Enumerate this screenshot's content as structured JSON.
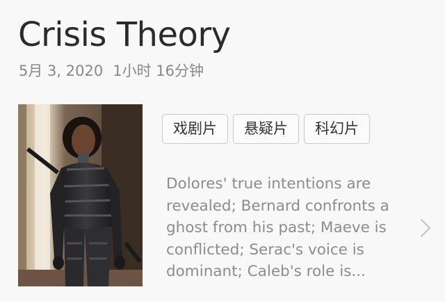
{
  "episode": {
    "title": "Crisis Theory",
    "date": "5月 3, 2020",
    "duration": "1小时 16分钟"
  },
  "genres": [
    "戏剧片",
    "悬疑片",
    "科幻片"
  ],
  "synopsis_lines": [
    "Dolores' true intentions are",
    "revealed; Bernard confronts a",
    "ghost from his past; Maeve is",
    "conflicted; Serac's voice is",
    "dominant; Caleb's role is..."
  ],
  "icons": {
    "disclosure": "chevron-right-icon"
  },
  "colors": {
    "background": "#f8f8f8",
    "title": "#2b2b2b",
    "secondary_text": "#888888",
    "tag_border": "#c8c8c8",
    "chevron": "#c4c4c4"
  }
}
